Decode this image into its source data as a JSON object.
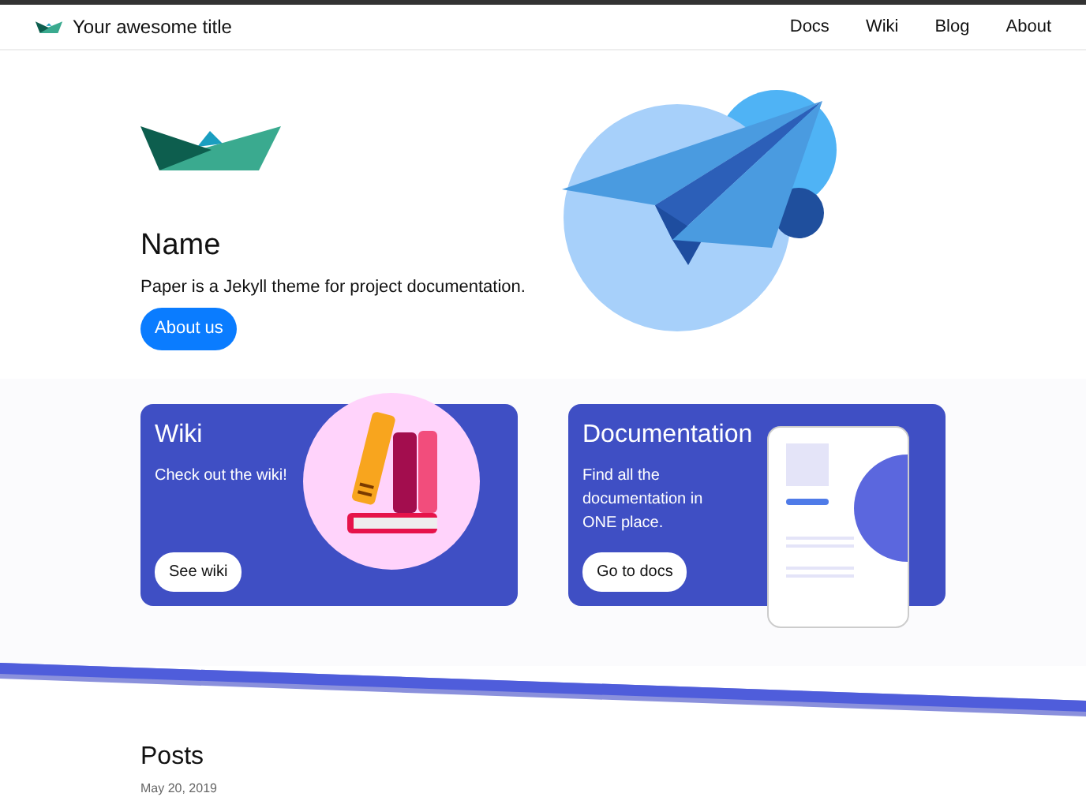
{
  "navbar": {
    "title": "Your awesome title",
    "links": [
      {
        "label": "Docs"
      },
      {
        "label": "Wiki"
      },
      {
        "label": "Blog"
      },
      {
        "label": "About"
      }
    ]
  },
  "hero": {
    "heading": "Name",
    "text": "Paper is a Jekyll theme for project documentation.",
    "button": "About us"
  },
  "cards": [
    {
      "kind": "books",
      "title": "Wiki",
      "text": "Check out the wiki!",
      "button": "See wiki"
    },
    {
      "kind": "document",
      "title": "Documentation",
      "text": "Find all the documentation in ONE place.",
      "button": "Go to docs"
    }
  ],
  "posts": {
    "heading": "Posts",
    "date": "May 20, 2019"
  }
}
